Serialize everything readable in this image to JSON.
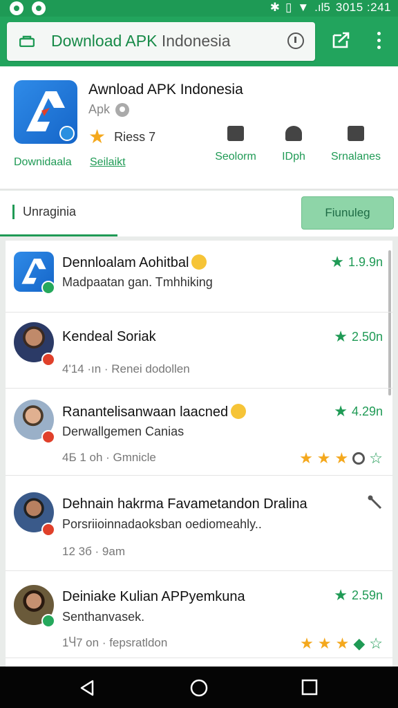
{
  "status_bar": {
    "time": "3015 :241",
    "signal": ".ıl5"
  },
  "toolbar": {
    "url_main": "Download APK",
    "url_dim": " Indonesia",
    "colors": {
      "bar": "#22a45d",
      "accent": "#1f9a55"
    }
  },
  "app": {
    "title": "Awnload APK Indonesia",
    "subtitle": "Apk",
    "rating_text": "Riess 7",
    "download_label": "Downidaala",
    "select_label": "Seilaikt",
    "actions": [
      {
        "label": "Seolorm",
        "icon": "document-icon"
      },
      {
        "label": "IDph",
        "icon": "person-icon"
      },
      {
        "label": "Srnalanes",
        "icon": "screen-icon"
      }
    ]
  },
  "tabs": {
    "active": "Unraginia",
    "follow_button": "Fiunuleg"
  },
  "items": [
    {
      "title": "Dennloalam Aohitbal",
      "emoji": true,
      "sub": "Madpaatan gan. Tmhhiking",
      "meta": "",
      "rating": "1.9.9n",
      "stars": 0,
      "avatar": "logo"
    },
    {
      "title": "Kendeal Soriak",
      "emoji": false,
      "sub": "",
      "meta": "4'14 ·ın · Renei dodollen",
      "rating": "2.50n",
      "stars": 0,
      "avatar": "person"
    },
    {
      "title": "Ranantelisanwaan laacned",
      "emoji": true,
      "sub": "Derwallgemen Canias",
      "meta": "4Б 1 oh · Gmnicle",
      "rating": "4.29n",
      "stars": 3,
      "avatar": "person"
    },
    {
      "title": "Dehnain hakrma Favametandon Dralina",
      "emoji": false,
      "sub": "Porsriioinnadaoksban oediomeahly..",
      "meta": "12 3б · 9am",
      "rating": "",
      "stars": 0,
      "avatar": "person"
    },
    {
      "title": "Deiniake Kulian APPyemkuna",
      "emoji": false,
      "sub": "Senthanvasek.",
      "meta": "1Ⴗ7 on · fepsratldon",
      "rating": "2.59n",
      "stars": 3,
      "avatar": "person"
    }
  ]
}
